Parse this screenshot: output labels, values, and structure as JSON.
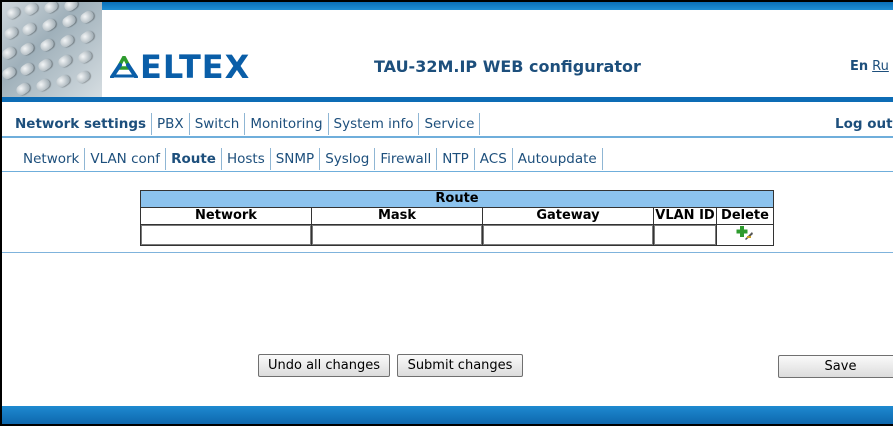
{
  "header": {
    "logo_text": "ELTEX",
    "title": "TAU-32M.IP WEB configurator",
    "lang_en": "En",
    "lang_ru": "Ru"
  },
  "main_tabs": [
    {
      "label": "Network settings",
      "active": true
    },
    {
      "label": "PBX",
      "active": false
    },
    {
      "label": "Switch",
      "active": false
    },
    {
      "label": "Monitoring",
      "active": false
    },
    {
      "label": "System info",
      "active": false
    },
    {
      "label": "Service",
      "active": false
    }
  ],
  "logout_label": "Log out",
  "sub_tabs": [
    {
      "label": "Network",
      "active": false
    },
    {
      "label": "VLAN conf",
      "active": false
    },
    {
      "label": "Route",
      "active": true
    },
    {
      "label": "Hosts",
      "active": false
    },
    {
      "label": "SNMP",
      "active": false
    },
    {
      "label": "Syslog",
      "active": false
    },
    {
      "label": "Firewall",
      "active": false
    },
    {
      "label": "NTP",
      "active": false
    },
    {
      "label": "ACS",
      "active": false
    },
    {
      "label": "Autoupdate",
      "active": false
    }
  ],
  "route_table": {
    "caption": "Route",
    "columns": [
      "Network",
      "Mask",
      "Gateway",
      "VLAN ID",
      "Delete"
    ],
    "rows": [
      {
        "network": "",
        "mask": "",
        "gateway": "",
        "vlan_id": ""
      }
    ],
    "add_icon": "add-route-icon"
  },
  "buttons": {
    "undo": "Undo all changes",
    "submit": "Submit changes",
    "save": "Save"
  },
  "colors": {
    "brand_blue": "#0a5ea8",
    "accent_green": "#2e9b2e",
    "table_caption_bg": "#8cc3ee"
  }
}
